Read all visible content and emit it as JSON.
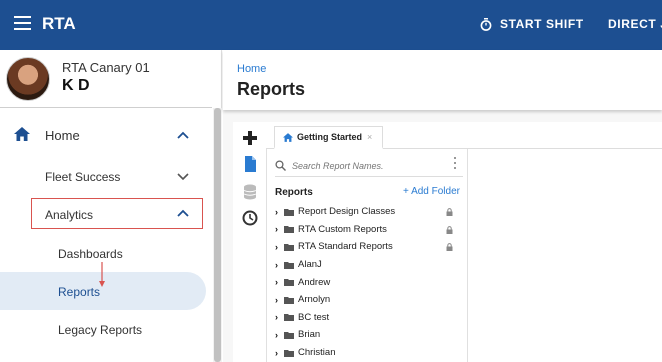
{
  "topbar": {
    "app_title": "RTA",
    "start_shift_label": "START SHIFT",
    "direct_label": "DIRECT J"
  },
  "sidebar": {
    "site_name": "RTA Canary 01",
    "user_initials": "K D",
    "nav": {
      "home": "Home",
      "fleet_success": "Fleet Success",
      "analytics": "Analytics",
      "dashboards": "Dashboards",
      "reports": "Reports",
      "legacy_reports": "Legacy Reports"
    }
  },
  "main": {
    "breadcrumb": "Home",
    "page_title": "Reports",
    "tab_label": "Getting Started",
    "search_placeholder": "Search Report Names.",
    "tree_heading": "Reports",
    "add_folder_label": "+ Add Folder",
    "tree_items": [
      {
        "label": "Report Design Classes",
        "locked": true
      },
      {
        "label": "RTA Custom Reports",
        "locked": true
      },
      {
        "label": "RTA Standard Reports",
        "locked": true
      },
      {
        "label": "AlanJ",
        "locked": false
      },
      {
        "label": "Andrew",
        "locked": false
      },
      {
        "label": "Arnolyn",
        "locked": false
      },
      {
        "label": "BC test",
        "locked": false
      },
      {
        "label": "Brian",
        "locked": false
      },
      {
        "label": "Christian",
        "locked": false
      }
    ]
  },
  "colors": {
    "topbar": "#1d4f91",
    "link": "#2a7bd1",
    "highlight_box": "#d9534f",
    "active_nav_bg": "#e2ebf5"
  },
  "icons": [
    "menu-icon",
    "timer-icon",
    "home-icon",
    "chevron-up-icon",
    "chevron-down-icon",
    "plus-icon",
    "document-icon",
    "database-icon",
    "history-icon",
    "search-icon",
    "kebab-menu-icon",
    "folder-icon",
    "lock-icon",
    "caret-right-icon"
  ]
}
